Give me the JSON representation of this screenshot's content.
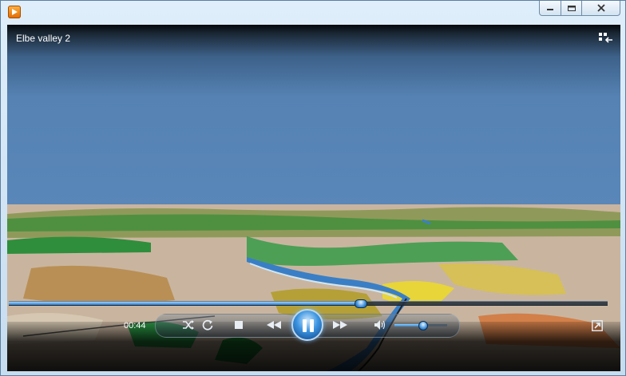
{
  "window": {
    "title": "Elbe valley 2",
    "controls": [
      "minimize",
      "maximize",
      "close"
    ]
  },
  "player": {
    "elapsed_time": "00:44",
    "seek_progress": 0.587,
    "volume_level": 0.53,
    "state": "playing"
  },
  "icons": {
    "app": "media-player-icon",
    "switch": "switch-to-library-icon",
    "shuffle": "shuffle-icon",
    "repeat": "repeat-icon",
    "stop": "stop-icon",
    "previous": "previous-icon",
    "pause": "pause-icon",
    "next": "next-icon",
    "mute": "speaker-icon",
    "fullscreen": "fullscreen-icon"
  },
  "colors": {
    "accent": "#3b94e0",
    "sky": "#5a87b9"
  }
}
